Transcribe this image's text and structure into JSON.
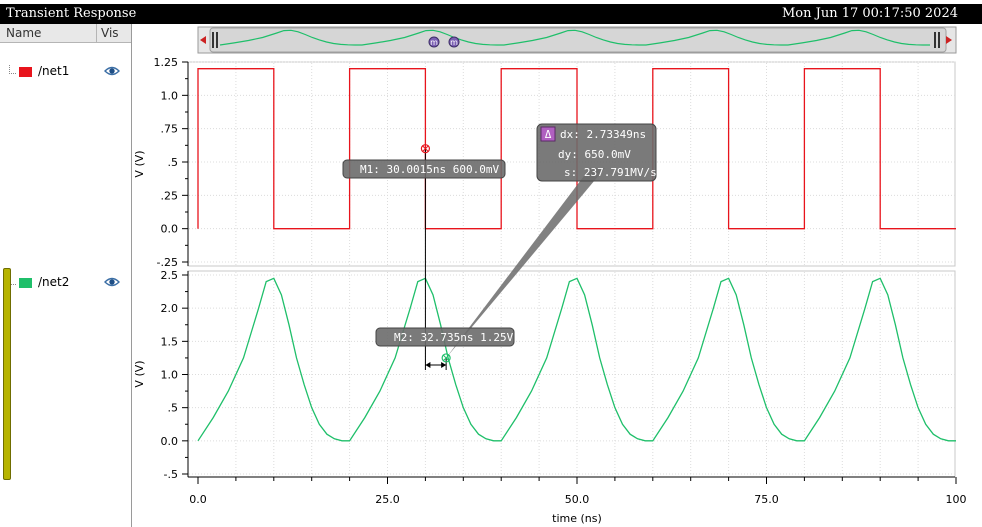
{
  "window": {
    "title": "Transient Response",
    "datetime": "Mon Jun 17 00:17:50 2024"
  },
  "signal_list": {
    "col_name": "Name",
    "col_vis": "Vis",
    "signals": [
      {
        "name": "/net1",
        "color": "#e8141c",
        "visible_icon": "eye-icon"
      },
      {
        "name": "/net2",
        "color": "#1fbf6a",
        "visible_icon": "eye-icon"
      }
    ]
  },
  "chart_data": [
    {
      "type": "line",
      "name": "/net1",
      "color": "#e8141c",
      "ylabel": "V (V)",
      "ylim": [
        -0.25,
        1.25
      ],
      "yticks": [
        "1.25",
        "1.0",
        ".75",
        ".5",
        ".25",
        "0.0",
        "-.25"
      ],
      "grid": true,
      "x": [
        0,
        0,
        10,
        10,
        20,
        20,
        30,
        30,
        40,
        40,
        50,
        50,
        60,
        60,
        70,
        70,
        80,
        80,
        90,
        90,
        100
      ],
      "y": [
        0,
        1.2,
        1.2,
        0,
        0,
        1.2,
        1.2,
        0,
        0,
        1.2,
        1.2,
        0,
        0,
        1.2,
        1.2,
        0,
        0,
        1.2,
        1.2,
        0,
        0
      ]
    },
    {
      "type": "line",
      "name": "/net2",
      "color": "#1fbf6a",
      "ylabel": "V (V)",
      "ylim": [
        -0.5,
        2.5
      ],
      "yticks": [
        "2.5",
        "2.0",
        "1.5",
        "1.0",
        ".5",
        "0.0",
        "-.5"
      ],
      "grid": true,
      "xlabel": "time (ns)",
      "xlim": [
        0,
        100
      ],
      "xticks": [
        "0.0",
        "25.0",
        "50.0",
        "75.0",
        "100"
      ],
      "x": [
        0,
        2,
        4,
        6,
        8,
        9,
        10,
        11,
        12,
        13,
        14,
        15,
        16,
        17,
        18,
        19,
        20,
        22,
        24,
        26,
        28,
        29,
        30,
        31,
        32,
        33,
        34,
        35,
        36,
        37,
        38,
        39,
        40,
        42,
        44,
        46,
        48,
        49,
        50,
        51,
        52,
        53,
        54,
        55,
        56,
        57,
        58,
        59,
        60,
        62,
        64,
        66,
        68,
        69,
        70,
        71,
        72,
        73,
        74,
        75,
        76,
        77,
        78,
        79,
        80,
        82,
        84,
        86,
        88,
        89,
        90,
        91,
        92,
        93,
        94,
        95,
        96,
        97,
        98,
        99,
        100
      ],
      "y": [
        0,
        0.35,
        0.75,
        1.25,
        2.0,
        2.4,
        2.45,
        2.2,
        1.75,
        1.25,
        0.85,
        0.5,
        0.25,
        0.1,
        0.03,
        0.0,
        0.0,
        0.35,
        0.75,
        1.25,
        2.0,
        2.4,
        2.45,
        2.2,
        1.75,
        1.25,
        0.85,
        0.5,
        0.25,
        0.1,
        0.03,
        0.0,
        0.0,
        0.35,
        0.75,
        1.25,
        2.0,
        2.4,
        2.45,
        2.2,
        1.75,
        1.25,
        0.85,
        0.5,
        0.25,
        0.1,
        0.03,
        0.0,
        0.0,
        0.35,
        0.75,
        1.25,
        2.0,
        2.4,
        2.45,
        2.2,
        1.75,
        1.25,
        0.85,
        0.5,
        0.25,
        0.1,
        0.03,
        0.0,
        0.0,
        0.35,
        0.75,
        1.25,
        2.0,
        2.4,
        2.45,
        2.2,
        1.75,
        1.25,
        0.85,
        0.5,
        0.25,
        0.1,
        0.03,
        0.0,
        0.0
      ]
    }
  ],
  "markers": {
    "m1": {
      "label": "M1: 30.0015ns 600.0mV",
      "x": 30.0015,
      "y": 0.6
    },
    "m2": {
      "label": "M2: 32.735ns 1.25V",
      "x": 32.735,
      "y": 1.25
    },
    "delta": {
      "symbol": "Δ",
      "dx": "dx: 2.73349ns",
      "dy": "dy: 650.0mV",
      "s": "s: 237.791MV/s"
    }
  },
  "overview": {
    "marker_glyph": "m"
  }
}
